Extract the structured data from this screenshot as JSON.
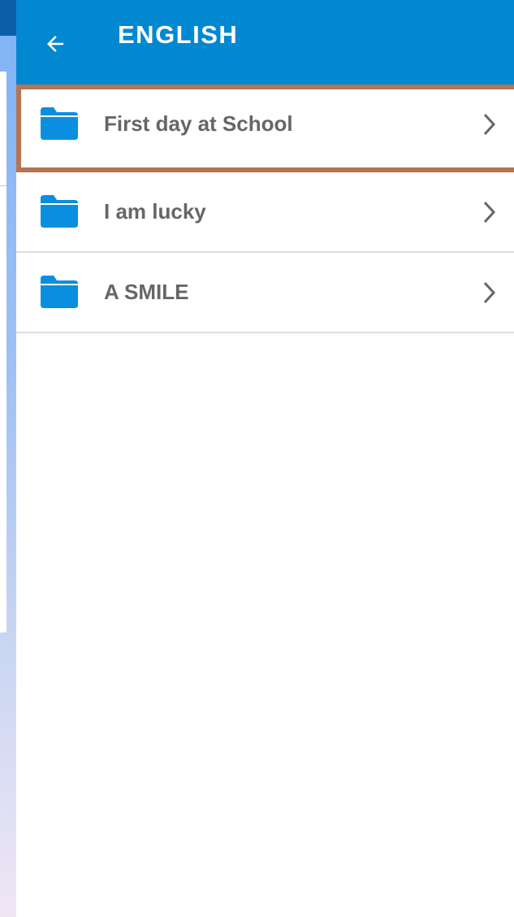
{
  "app_bar": {
    "title": "ENGLISH",
    "back_icon": "arrow-left-icon",
    "color": "#0288d1"
  },
  "list": {
    "items": [
      {
        "label": "First day at School",
        "icon": "folder-icon",
        "selected": true
      },
      {
        "label": "I am lucky",
        "icon": "folder-icon",
        "selected": false
      },
      {
        "label": "A SMILE",
        "icon": "folder-icon",
        "selected": false
      }
    ]
  },
  "colors": {
    "folder": "#0a8fe0",
    "selection_border": "#b77452",
    "label_text": "#666666"
  }
}
